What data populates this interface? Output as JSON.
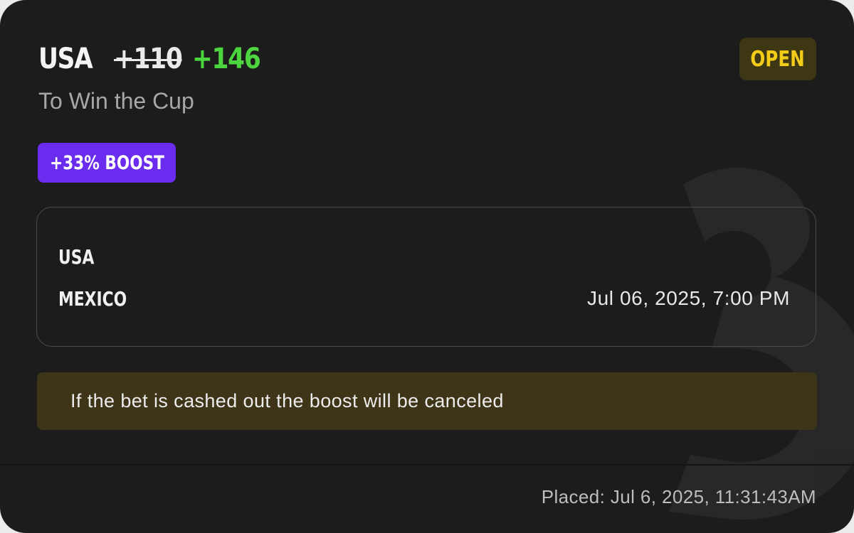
{
  "bet": {
    "selection": "USA",
    "original_odds": "+110",
    "boosted_odds": "+146",
    "market": "To Win the Cup",
    "status": "OPEN",
    "boost_label": "+33% BOOST"
  },
  "matchup": {
    "home_team": "USA",
    "away_team": "MEXICO",
    "event_time": "Jul 06, 2025, 7:00 PM"
  },
  "notice": {
    "text": "If the bet is cashed out the boost will be canceled"
  },
  "footer": {
    "placed": "Placed: Jul 6, 2025, 11:31:43AM"
  },
  "colors": {
    "card_background": "#1c1c1c",
    "boosted_odds": "#4cd53f",
    "status_text": "#f3cc1a",
    "status_background": "#3d3714",
    "boost_badge": "#6a2df0",
    "notice_background": "#3e3519"
  },
  "icons": {
    "watermark": "brand-logo-watermark"
  }
}
